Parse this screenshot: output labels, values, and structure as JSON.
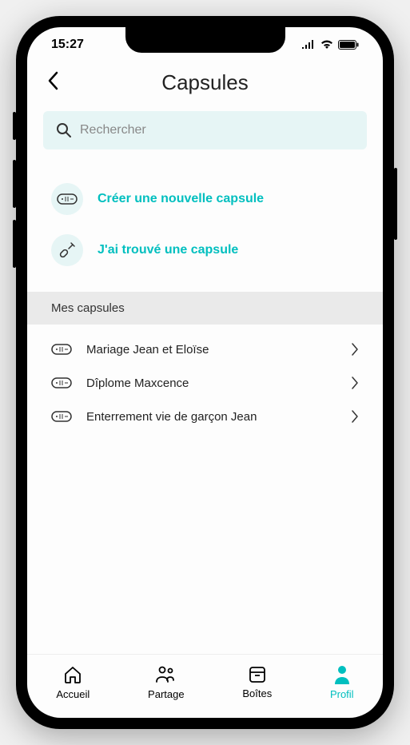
{
  "status": {
    "time": "15:27"
  },
  "header": {
    "title": "Capsules"
  },
  "search": {
    "placeholder": "Rechercher"
  },
  "actions": {
    "create": "Créer une nouvelle capsule",
    "found": "J'ai trouvé une capsule"
  },
  "section": {
    "my_capsules": "Mes capsules"
  },
  "capsules": [
    {
      "label": "Mariage Jean et Eloïse"
    },
    {
      "label": "Dîplome Maxcence"
    },
    {
      "label": "Enterrement vie de garçon Jean"
    }
  ],
  "nav": {
    "home": "Accueil",
    "share": "Partage",
    "boxes": "Boîtes",
    "profile": "Profil"
  }
}
